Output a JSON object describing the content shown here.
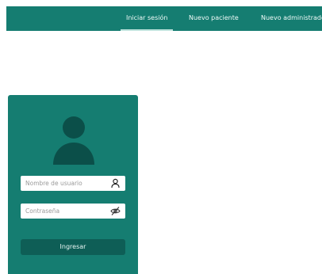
{
  "nav": {
    "items": [
      {
        "label": "Iniciar sesión",
        "active": true
      },
      {
        "label": "Nuevo paciente",
        "active": false
      },
      {
        "label": "Nuevo administrador",
        "active": false
      }
    ]
  },
  "login": {
    "username_placeholder": "Nombre de usuario",
    "username_value": "",
    "password_placeholder": "Contraseña",
    "password_value": "",
    "submit_label": "Ingresar",
    "icons": {
      "avatar": "user-avatar-icon",
      "username": "user-icon",
      "password": "eye-off-icon"
    }
  },
  "colors": {
    "primary": "#157d71",
    "button": "#0e5e56",
    "avatar": "#0b4f49",
    "background": "#ffffff"
  }
}
